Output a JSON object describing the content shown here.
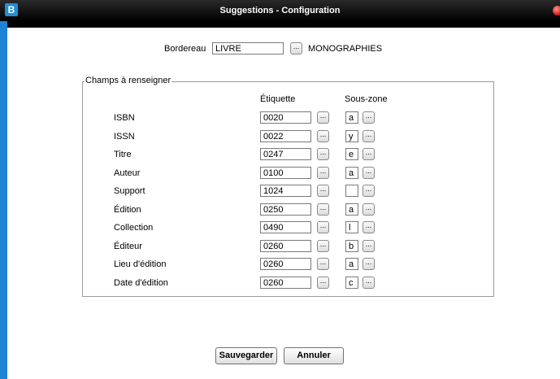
{
  "window": {
    "title": "Suggestions - Configuration",
    "app_icon_glyph": "B"
  },
  "bordereau": {
    "label": "Bordereau",
    "value": "LIVRE",
    "browse_label": "...",
    "description": "MONOGRAPHIES"
  },
  "fieldset": {
    "legend": "Champs à renseigner",
    "col_etiquette": "Étiquette",
    "col_souszone": "Sous-zone",
    "rows": [
      {
        "label": "ISBN",
        "etiquette": "0020",
        "souszone": "a"
      },
      {
        "label": "ISSN",
        "etiquette": "0022",
        "souszone": "y"
      },
      {
        "label": "Titre",
        "etiquette": "0247",
        "souszone": "e"
      },
      {
        "label": "Auteur",
        "etiquette": "0100",
        "souszone": "a"
      },
      {
        "label": "Support",
        "etiquette": "1024",
        "souszone": ""
      },
      {
        "label": "Édition",
        "etiquette": "0250",
        "souszone": "a"
      },
      {
        "label": "Collection",
        "etiquette": "0490",
        "souszone": "l"
      },
      {
        "label": "Éditeur",
        "etiquette": "0260",
        "souszone": "b"
      },
      {
        "label": "Lieu d'édition",
        "etiquette": "0260",
        "souszone": "a"
      },
      {
        "label": "Date d'édition",
        "etiquette": "0260",
        "souszone": "c"
      }
    ],
    "browse_label": "..."
  },
  "buttons": {
    "save": "Sauvegarder",
    "cancel": "Annuler"
  },
  "colors": {
    "frame_blue": "#1e83d2",
    "titlebar": "#000000",
    "close": "#dd2222"
  },
  "icons": {
    "app": "app-logo-icon",
    "close": "close-icon"
  }
}
